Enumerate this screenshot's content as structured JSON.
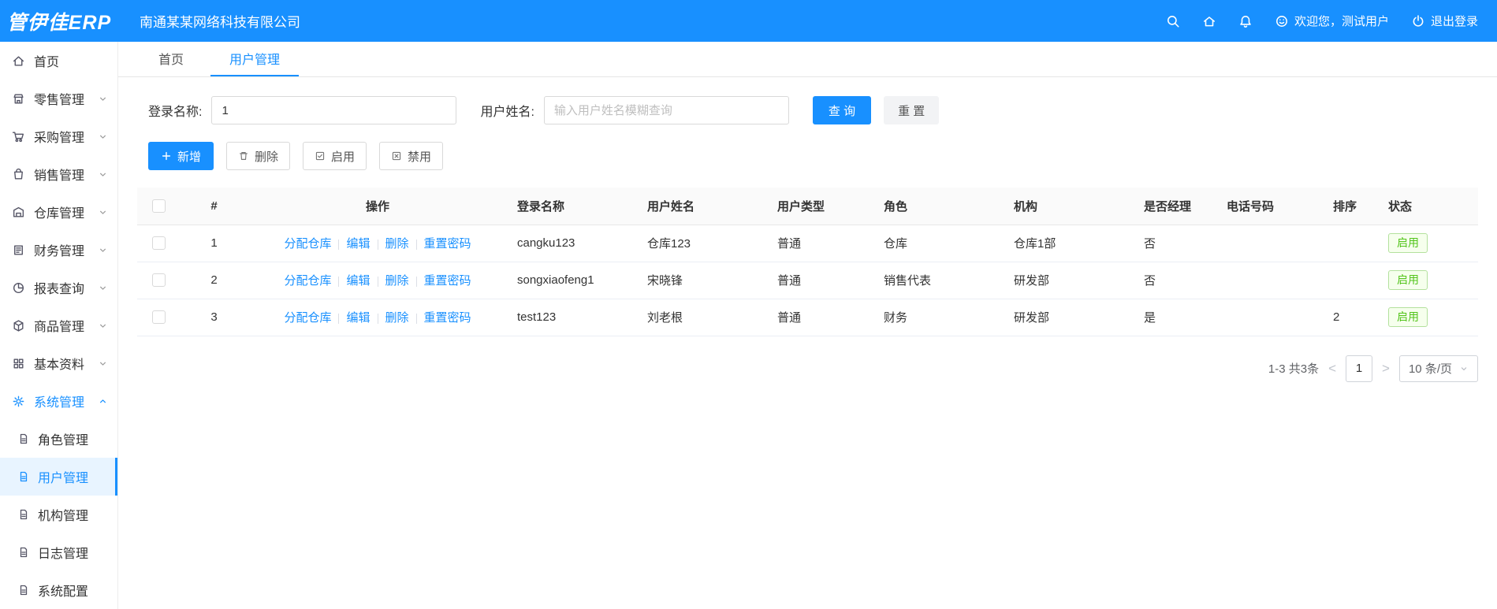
{
  "colors": {
    "primary": "#1890ff",
    "success": "#52c41a"
  },
  "topbar": {
    "logo": "管伊佳ERP",
    "company": "南通某某网络科技有限公司",
    "welcome": "欢迎您，测试用户",
    "logout": "退出登录"
  },
  "sidebar": {
    "items": [
      {
        "label": "首页"
      },
      {
        "label": "零售管理"
      },
      {
        "label": "采购管理"
      },
      {
        "label": "销售管理"
      },
      {
        "label": "仓库管理"
      },
      {
        "label": "财务管理"
      },
      {
        "label": "报表查询"
      },
      {
        "label": "商品管理"
      },
      {
        "label": "基本资料"
      },
      {
        "label": "系统管理"
      }
    ],
    "subitems": [
      {
        "label": "角色管理"
      },
      {
        "label": "用户管理"
      },
      {
        "label": "机构管理"
      },
      {
        "label": "日志管理"
      },
      {
        "label": "系统配置"
      }
    ]
  },
  "tabs": {
    "home": "首页",
    "current": "用户管理"
  },
  "filters": {
    "login_label": "登录名称:",
    "login_value": "1",
    "name_label": "用户姓名:",
    "name_placeholder": "输入用户姓名模糊查询",
    "search_btn": "查 询",
    "reset_btn": "重 置"
  },
  "toolbar": {
    "add": "新增",
    "delete": "删除",
    "enable": "启用",
    "disable": "禁用"
  },
  "table": {
    "headers": {
      "index": "#",
      "operation": "操作",
      "login": "登录名称",
      "name": "用户姓名",
      "type": "用户类型",
      "role": "角色",
      "org": "机构",
      "manager": "是否经理",
      "phone": "电话号码",
      "sort": "排序",
      "status": "状态"
    },
    "actions": [
      "分配仓库",
      "编辑",
      "删除",
      "重置密码"
    ],
    "rows": [
      {
        "index": "1",
        "login": "cangku123",
        "name": "仓库123",
        "type": "普通",
        "role": "仓库",
        "org": "仓库1部",
        "manager": "否",
        "phone": "",
        "sort": "",
        "status": "启用"
      },
      {
        "index": "2",
        "login": "songxiaofeng1",
        "name": "宋晓锋",
        "type": "普通",
        "role": "销售代表",
        "org": "研发部",
        "manager": "否",
        "phone": "",
        "sort": "",
        "status": "启用"
      },
      {
        "index": "3",
        "login": "test123",
        "name": "刘老根",
        "type": "普通",
        "role": "财务",
        "org": "研发部",
        "manager": "是",
        "phone": "",
        "sort": "2",
        "status": "启用"
      }
    ]
  },
  "pagination": {
    "total": "1-3 共3条",
    "page": "1",
    "page_size": "10 条/页"
  }
}
